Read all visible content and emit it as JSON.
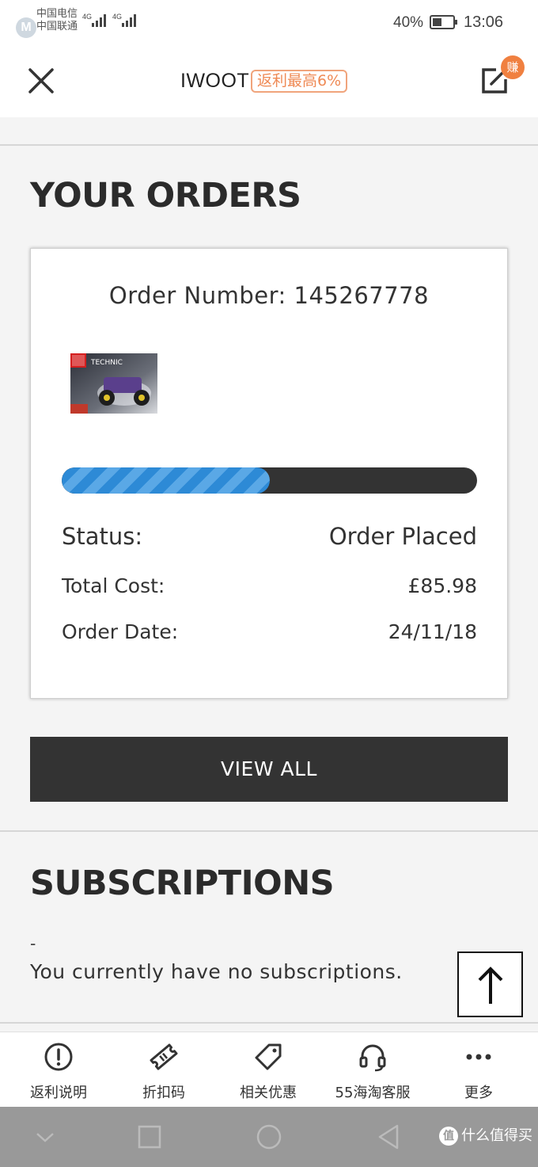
{
  "status_bar": {
    "carrier_1": "中国电信",
    "carrier_2": "中国联通",
    "network_1": "4G",
    "network_2": "4G",
    "battery_percent": "40%",
    "battery_level": 0.4,
    "time": "13:06"
  },
  "header": {
    "title": "IWOOT",
    "cashback_label": "返利最高6%",
    "earn_badge": "赚",
    "close_icon": "close-icon",
    "share_icon": "share-edit-icon"
  },
  "orders": {
    "section_title": "YOUR ORDERS",
    "order_number": "Order Number: 145267778",
    "product_image": "lego-technic-box",
    "progress": 0.5,
    "status_label": "Status:",
    "status_value": "Order Placed",
    "total_label": "Total Cost:",
    "total_value": "£85.98",
    "date_label": "Order Date:",
    "date_value": "24/11/18",
    "view_all": "VIEW ALL"
  },
  "subscriptions": {
    "section_title": "SUBSCRIPTIONS",
    "dash": "-",
    "empty_message": "You currently have no subscriptions."
  },
  "toolbar": {
    "items": [
      {
        "label": "返利说明",
        "icon": "info-icon"
      },
      {
        "label": "折扣码",
        "icon": "ticket-icon"
      },
      {
        "label": "相关优惠",
        "icon": "tag-icon"
      },
      {
        "label": "55海淘客服",
        "icon": "headset-icon"
      },
      {
        "label": "更多",
        "icon": "more-icon"
      }
    ]
  },
  "watermark": {
    "badge": "值",
    "text": "什么值得买"
  },
  "colors": {
    "accent_orange": "#ef8a55",
    "progress_blue": "#2d8ad6",
    "dark": "#333333"
  }
}
